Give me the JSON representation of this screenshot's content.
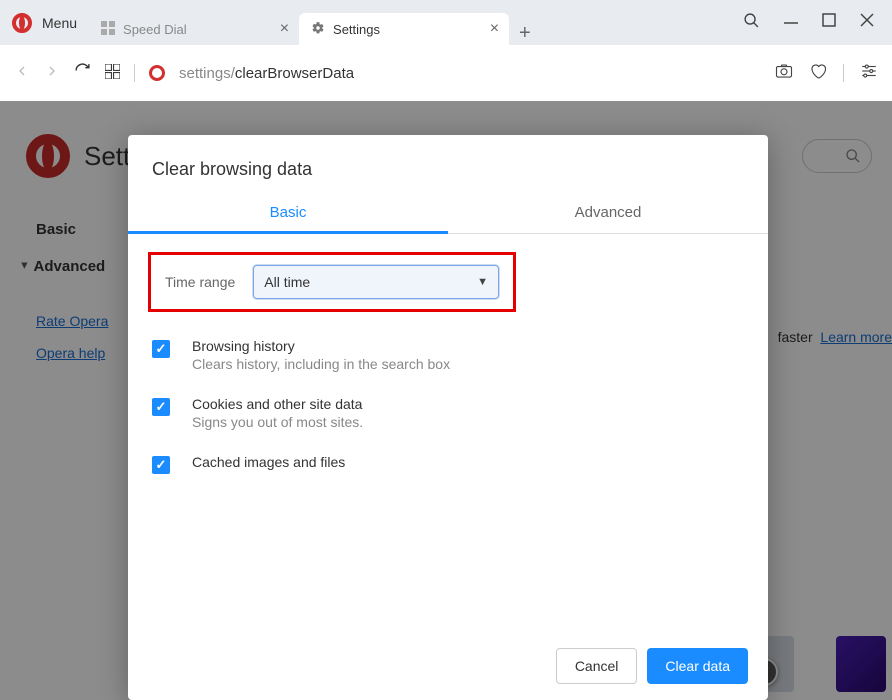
{
  "titlebar": {
    "menu_label": "Menu",
    "tabs": [
      {
        "label": "Speed Dial",
        "active": false
      },
      {
        "label": "Settings",
        "active": true
      }
    ]
  },
  "addressbar": {
    "url_prefix": "settings/",
    "url_path": "clearBrowserData"
  },
  "settings": {
    "title": "Settings",
    "sidebar": {
      "basic": "Basic",
      "advanced": "Advanced",
      "rate": "Rate Opera",
      "help": "Opera help"
    },
    "teaser": {
      "text": "faster",
      "link": "Learn more"
    }
  },
  "modal": {
    "title": "Clear browsing data",
    "tabs": {
      "basic": "Basic",
      "advanced": "Advanced"
    },
    "time_label": "Time range",
    "time_value": "All time",
    "items": [
      {
        "title": "Browsing history",
        "sub": "Clears history, including in the search box",
        "checked": true
      },
      {
        "title": "Cookies and other site data",
        "sub": "Signs you out of most sites.",
        "checked": true
      },
      {
        "title": "Cached images and files",
        "sub": "",
        "checked": true
      }
    ],
    "cancel": "Cancel",
    "clear": "Clear data"
  }
}
